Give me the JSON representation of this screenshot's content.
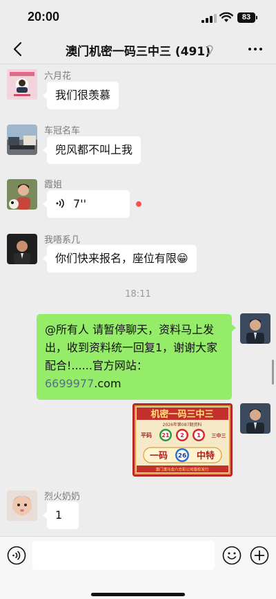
{
  "status_bar": {
    "time": "20:00",
    "battery": "83"
  },
  "header": {
    "title": "澳门机密一码三中三 (491)"
  },
  "messages": [
    {
      "sender": "六月花",
      "text": "我们很羡慕"
    },
    {
      "sender": "车冠名车",
      "text": "兜风都不叫上我"
    },
    {
      "sender": "霞姐",
      "text": "7''",
      "type": "voice"
    },
    {
      "sender": "我唔系几",
      "text": "你们快来报名，座位有限😁"
    },
    {
      "type": "timestamp",
      "text": "18:11"
    },
    {
      "type": "self",
      "text_prefix": "@所有人 请暂停聊天，资料马上发出，收到资料统一回复1，谢谢大家配合!......官方网站：",
      "link": "6699977",
      "text_suffix": ".com"
    },
    {
      "type": "self-image"
    },
    {
      "sender": "烈火奶奶",
      "text": "1"
    }
  ],
  "poster": {
    "title": "机密一码三中三",
    "subtitle": "2026年第087期资料",
    "left_label": "平码",
    "right_label": "三中三",
    "numbers": [
      "21",
      "2",
      "1"
    ],
    "special_left": "一码",
    "special_number": "26",
    "special_right": "中特",
    "footer": "澳门濠马会六合彩公司版权发行"
  },
  "colors": {
    "self_bubble": "#95ec69",
    "link": "#576b95",
    "background": "#ededed"
  }
}
